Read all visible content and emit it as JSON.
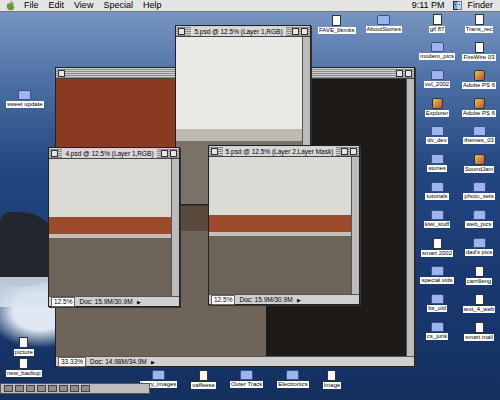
{
  "menubar": {
    "menus": [
      "File",
      "Edit",
      "View",
      "Special",
      "Help"
    ],
    "clock": "9:11 PM",
    "app": "Finder"
  },
  "windows": [
    {
      "zoom": "33.33%",
      "doc": "Doc: 14.98M/34.9M",
      "arrow": "▶"
    },
    {
      "title": "5.psd @ 12.5% (Layer 1,RGB)"
    },
    {
      "title": "4.psd @ 12.5% (Layer 1,RGB)",
      "zoom": "12.5%",
      "doc": "Doc: 15.9M/30.9M",
      "arrow": "▶"
    },
    {
      "title": "5.psd @ 12.5% (Layer 2,Layer Mask)",
      "zoom": "12.5%",
      "doc": "Doc: 15.9M/30.9M",
      "arrow": "▶"
    }
  ],
  "desktop": {
    "top": [
      {
        "label": "FAVE_bkmks",
        "kind": "file"
      },
      {
        "label": "AboutStories",
        "kind": "folder"
      }
    ],
    "left": [
      {
        "label": "sweet update",
        "kind": "folder"
      }
    ],
    "left_bottom": [
      {
        "label": "picture",
        "kind": "file"
      },
      {
        "label": "new_backup",
        "kind": "file"
      }
    ],
    "right": [
      {
        "label": "gif 87",
        "kind": "file"
      },
      {
        "label": "Trans_rec",
        "kind": "file"
      },
      {
        "label": "modem_pics",
        "kind": "folder"
      },
      {
        "label": "FireWire 03",
        "kind": "file"
      },
      {
        "label": "vol_2002",
        "kind": "folder"
      },
      {
        "label": "Adobe PS 6",
        "kind": "app"
      },
      {
        "label": "Explorer",
        "kind": "app"
      },
      {
        "label": "Adobe PS 6",
        "kind": "app"
      },
      {
        "label": "dv_dev",
        "kind": "folder"
      },
      {
        "label": "themes_03",
        "kind": "folder"
      },
      {
        "label": "stories",
        "kind": "folder"
      },
      {
        "label": "SoundJam",
        "kind": "app"
      },
      {
        "label": "tutorials",
        "kind": "folder"
      },
      {
        "label": "photo_sets",
        "kind": "folder"
      },
      {
        "label": "kiwi_stuff",
        "kind": "folder"
      },
      {
        "label": "web_pics",
        "kind": "folder"
      },
      {
        "label": "smart 2002",
        "kind": "file"
      },
      {
        "label": "dad's pics",
        "kind": "folder"
      },
      {
        "label": "special vids",
        "kind": "folder"
      },
      {
        "label": "carrilleng",
        "kind": "file"
      },
      {
        "label": "bs_old",
        "kind": "folder"
      },
      {
        "label": "text_4_web",
        "kind": "file"
      },
      {
        "label": "cs_junk",
        "kind": "folder"
      },
      {
        "label": "smart mail",
        "kind": "file"
      }
    ],
    "bottom": [
      {
        "label": "hazy_images",
        "kind": "folder"
      },
      {
        "label": "vaffeese",
        "kind": "file"
      },
      {
        "label": "Outer Track",
        "kind": "folder"
      },
      {
        "label": "Electronics",
        "kind": "folder"
      },
      {
        "label": "Image",
        "kind": "file"
      }
    ]
  }
}
